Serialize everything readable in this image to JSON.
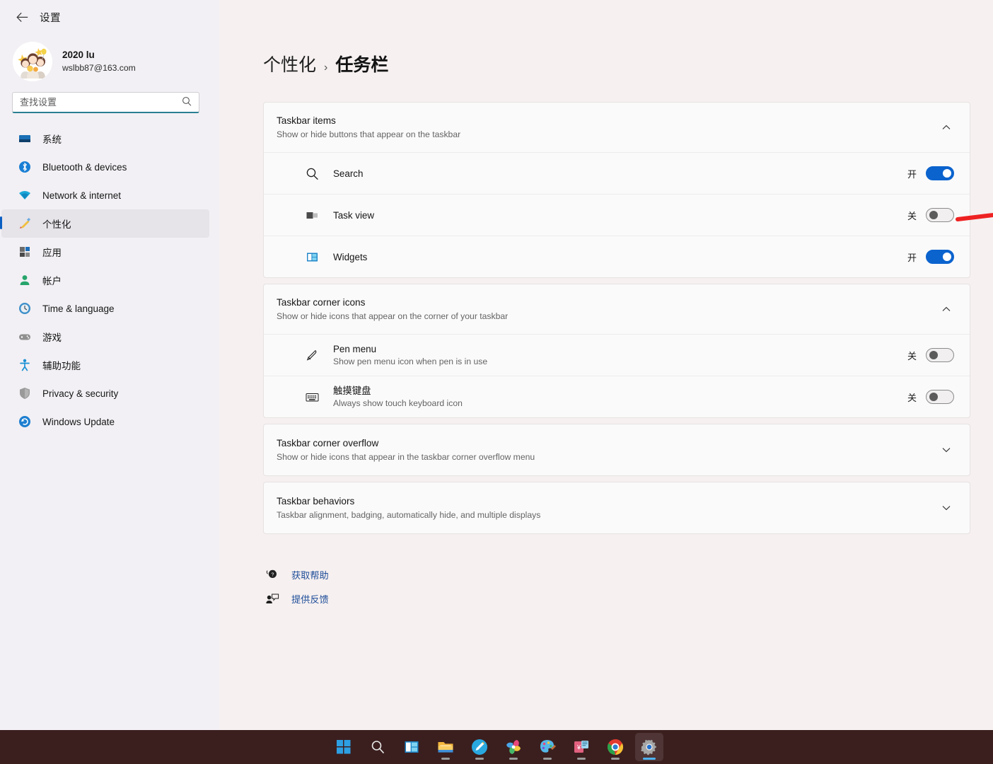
{
  "window": {
    "title": "设置",
    "back_icon": "back-arrow-icon"
  },
  "profile": {
    "name": "2020 lu",
    "email": "wslbb87@163.com",
    "avatar_alt": "cartoon-children-avatar"
  },
  "search": {
    "placeholder": "查找设置",
    "value": "",
    "icon": "search-icon"
  },
  "sidebar": {
    "items": [
      {
        "label": "系统",
        "icon": "system-monitor-icon",
        "selected": false
      },
      {
        "label": "Bluetooth & devices",
        "icon": "bluetooth-icon",
        "selected": false
      },
      {
        "label": "Network & internet",
        "icon": "wifi-icon",
        "selected": false
      },
      {
        "label": "个性化",
        "icon": "personalization-brush-icon",
        "selected": true
      },
      {
        "label": "应用",
        "icon": "apps-icon",
        "selected": false
      },
      {
        "label": "帐户",
        "icon": "account-person-icon",
        "selected": false
      },
      {
        "label": "Time & language",
        "icon": "clock-globe-icon",
        "selected": false
      },
      {
        "label": "游戏",
        "icon": "gaming-controller-icon",
        "selected": false
      },
      {
        "label": "辅助功能",
        "icon": "accessibility-person-icon",
        "selected": false
      },
      {
        "label": "Privacy & security",
        "icon": "shield-icon",
        "selected": false
      },
      {
        "label": "Windows Update",
        "icon": "update-refresh-icon",
        "selected": false
      }
    ]
  },
  "breadcrumb": {
    "root": "个性化",
    "separator": "›",
    "leaf": "任务栏"
  },
  "sections": [
    {
      "id": "taskbar-items",
      "title": "Taskbar items",
      "subtitle": "Show or hide buttons that appear on the taskbar",
      "expanded": true,
      "chevron": "chevron-up-icon",
      "rows": [
        {
          "name": "Search",
          "sub": "",
          "icon": "search-icon",
          "state_label": "开",
          "on": true
        },
        {
          "name": "Task view",
          "sub": "",
          "icon": "task-view-icon",
          "state_label": "关",
          "on": false
        },
        {
          "name": "Widgets",
          "sub": "",
          "icon": "widgets-icon",
          "state_label": "开",
          "on": true
        }
      ]
    },
    {
      "id": "taskbar-corner-icons",
      "title": "Taskbar corner icons",
      "subtitle": "Show or hide icons that appear on the corner of your taskbar",
      "expanded": true,
      "chevron": "chevron-up-icon",
      "rows": [
        {
          "name": "Pen menu",
          "sub": "Show pen menu icon when pen is in use",
          "icon": "pen-icon",
          "state_label": "关",
          "on": false
        },
        {
          "name": "触摸键盘",
          "sub": "Always show touch keyboard icon",
          "icon": "keyboard-icon",
          "state_label": "关",
          "on": false
        }
      ]
    },
    {
      "id": "taskbar-corner-overflow",
      "title": "Taskbar corner overflow",
      "subtitle": "Show or hide icons that appear in the taskbar corner overflow menu",
      "expanded": false,
      "chevron": "chevron-down-icon",
      "rows": []
    },
    {
      "id": "taskbar-behaviors",
      "title": "Taskbar behaviors",
      "subtitle": "Taskbar alignment, badging, automatically hide, and multiple displays",
      "expanded": false,
      "chevron": "chevron-down-icon",
      "rows": []
    }
  ],
  "footer_links": [
    {
      "label": "获取帮助",
      "icon": "help-question-icon"
    },
    {
      "label": "提供反馈",
      "icon": "feedback-person-icon"
    }
  ],
  "annotation": {
    "type": "arrow",
    "color": "#ee2222",
    "points_at": "task-view-toggle"
  },
  "taskbar": {
    "background": "#3b1f1f",
    "items": [
      {
        "name": "start-button",
        "icon": "windows-logo-icon",
        "running": false,
        "active": false
      },
      {
        "name": "search-button",
        "icon": "search-icon",
        "running": false,
        "active": false
      },
      {
        "name": "widgets-button",
        "icon": "widgets-icon",
        "running": false,
        "active": false
      },
      {
        "name": "file-explorer",
        "icon": "folder-icon",
        "running": true,
        "active": false
      },
      {
        "name": "edge-browser",
        "icon": "blue-circle-pencil-icon",
        "running": true,
        "active": false
      },
      {
        "name": "colorful-browser",
        "icon": "color-pinwheel-icon",
        "running": true,
        "active": false
      },
      {
        "name": "paint-app",
        "icon": "paint-palette-icon",
        "running": true,
        "active": false
      },
      {
        "name": "finance-app",
        "icon": "yen-card-icon",
        "running": true,
        "active": false
      },
      {
        "name": "chrome-browser",
        "icon": "chrome-icon",
        "running": true,
        "active": false
      },
      {
        "name": "settings-app",
        "icon": "gear-icon",
        "running": true,
        "active": true
      }
    ]
  },
  "colors": {
    "accent": "#0b63ce",
    "link": "#1f4e99",
    "page_bg": "#f6f0f0",
    "sidebar_bg": "#f2f0f4",
    "card_bg": "#fbfafa",
    "annotation_red": "#ee2222"
  }
}
